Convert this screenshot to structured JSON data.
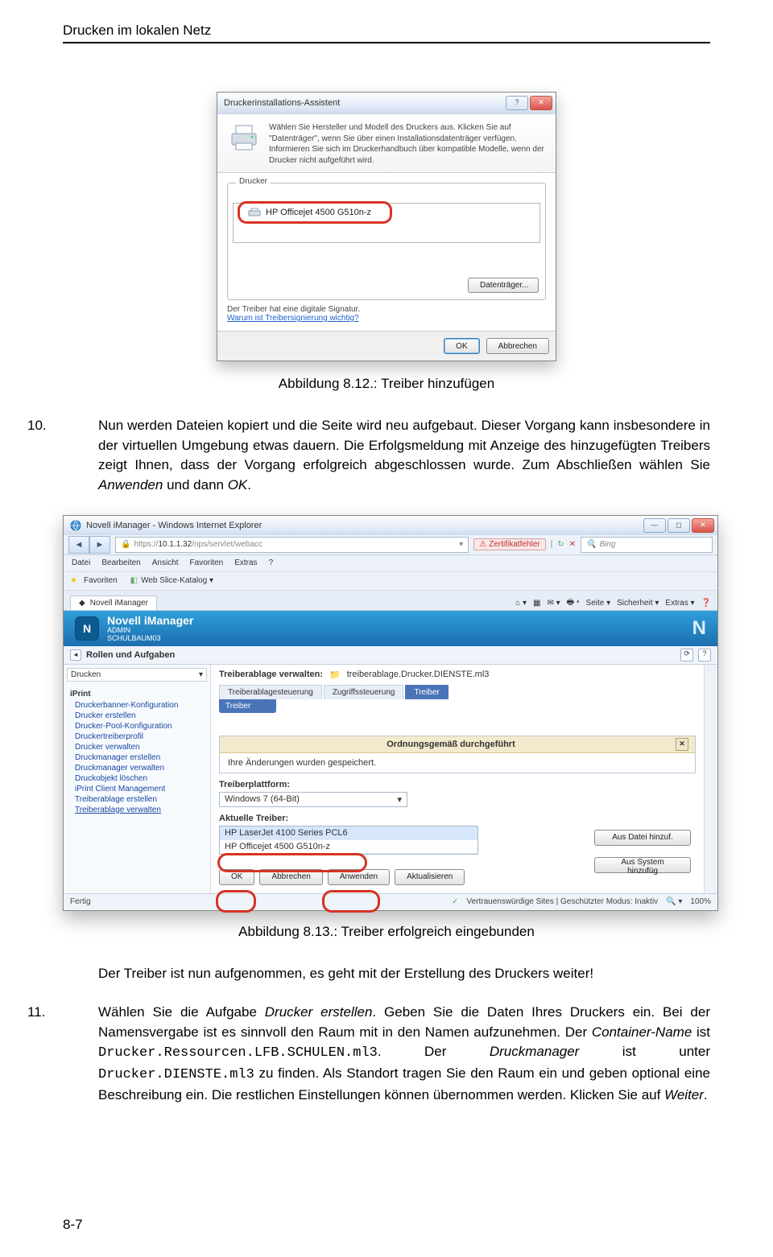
{
  "header": {
    "running": "Drucken im lokalen Netz"
  },
  "wizard1": {
    "title": "Druckerinstallations-Assistent",
    "intro": "Wählen Sie Hersteller und Modell des Druckers aus. Klicken Sie auf \"Datenträger\", wenn Sie über einen Installationsdatenträger verfügen. Informieren Sie sich im Druckerhandbuch über kompatible Modelle, wenn der Drucker nicht aufgeführt wird.",
    "legend": "Drucker",
    "selected": "HP Officejet 4500 G510n-z",
    "datenButton": "Datenträger...",
    "signed": "Der Treiber hat eine digitale Signatur.",
    "whyLink": "Warum ist Treibersignierung wichtig?",
    "ok": "OK",
    "cancel": "Abbrechen"
  },
  "caption1": "Abbildung 8.12.: Treiber hinzufügen",
  "para1_num": "10.",
  "para1": "Nun werden Dateien kopiert und die Seite wird neu aufgebaut. Dieser Vorgang kann insbesondere in der virtuellen Umgebung etwas dauern. Die Erfolgsmeldung mit Anzeige des hinzugefügten Treibers zeigt Ihnen, dass der Vorgang erfolgreich abgeschlossen wurde. Zum Abschließen wählen Sie ",
  "para1_em1": "Anwenden",
  "para1_mid": " und dann ",
  "para1_em2": "OK",
  "para1_end": ".",
  "ie": {
    "title": "Novell iManager - Windows Internet Explorer",
    "url_host": "10.1.1.32",
    "url_path": "/nps/servlet/webacc",
    "cert": "Zertifikatfehler",
    "searchPlaceholder": "Bing",
    "menus": [
      "Datei",
      "Bearbeiten",
      "Ansicht",
      "Favoriten",
      "Extras",
      "?"
    ],
    "favLabel": "Favoriten",
    "favItem": "Web Slice-Katalog ▾",
    "tabLabel": "Novell iManager",
    "toolSeite": "Seite ▾",
    "toolSich": "Sicherheit ▾",
    "toolExtras": "Extras ▾"
  },
  "imgr": {
    "title": "Novell iManager",
    "admin": "ADMIN",
    "tree": "SCHULBAUM03",
    "roles": "Rollen und Aufgaben",
    "sideSelected": "Drucken",
    "sideGroup": "iPrint",
    "sideLinks": [
      "Druckerbanner-Konfiguration",
      "Drucker erstellen",
      "Drucker-Pool-Konfiguration",
      "Druckertreiberprofil",
      "Drucker verwalten",
      "Druckmanager erstellen",
      "Druckmanager verwalten",
      "Druckobjekt löschen",
      "iPrint Client Management",
      "Treiberablage erstellen",
      "Treiberablage verwalten"
    ],
    "manageLabel": "Treiberablage verwalten:",
    "manageValue": "treiberablage.Drucker.DIENSTE.ml3",
    "tabs": [
      "Treiberablagesteuerung",
      "Zugriffssteuerung",
      "Treiber"
    ],
    "subtab": "Treiber",
    "okTitle": "Ordnungsgemäß durchgeführt",
    "okBody": "Ihre Änderungen wurden gespeichert.",
    "platformLabel": "Treiberplattform:",
    "platformValue": "Windows 7 (64-Bit)",
    "currentLabel": "Aktuelle Treiber:",
    "driver1": "HP LaserJet 4100 Series PCL6",
    "driver2": "HP Officejet 4500 G510n-z",
    "addFile": "Aus Datei hinzuf.",
    "addSys": "Aus System hinzufüg",
    "btns": [
      "OK",
      "Abbrechen",
      "Anwenden",
      "Aktualisieren"
    ],
    "statusLeft": "Fertig",
    "statusMid": "Vertrauenswürdige Sites | Geschützter Modus: Inaktiv",
    "zoom": "100%"
  },
  "caption2": "Abbildung 8.13.: Treiber erfolgreich eingebunden",
  "para2": "Der Treiber ist nun aufgenommen, es geht mit der Erstellung des Druckers weiter!",
  "para3_num": "11.",
  "para3_a": "Wählen Sie die Aufgabe ",
  "para3_em1": "Drucker erstellen",
  "para3_b": ". Geben Sie die Daten Ihres Druckers ein. Bei der Namensvergabe ist es sinnvoll den Raum mit in den Namen aufzunehmen. Der ",
  "para3_em2": "Container-Name",
  "para3_c": " ist ",
  "para3_code1": "Drucker.Ressourcen.LFB.SCHULEN.ml3",
  "para3_d": ". Der ",
  "para3_em3": "Druckmanager",
  "para3_e": " ist unter ",
  "para3_code2": "Drucker.DIENSTE.ml3",
  "para3_f": " zu finden. Als Standort tragen Sie den Raum ein und geben optional eine Beschreibung ein. Die restlichen Einstellungen können übernommen werden. Klicken Sie auf ",
  "para3_em4": "Weiter",
  "para3_g": ".",
  "pageNum": "8-7"
}
